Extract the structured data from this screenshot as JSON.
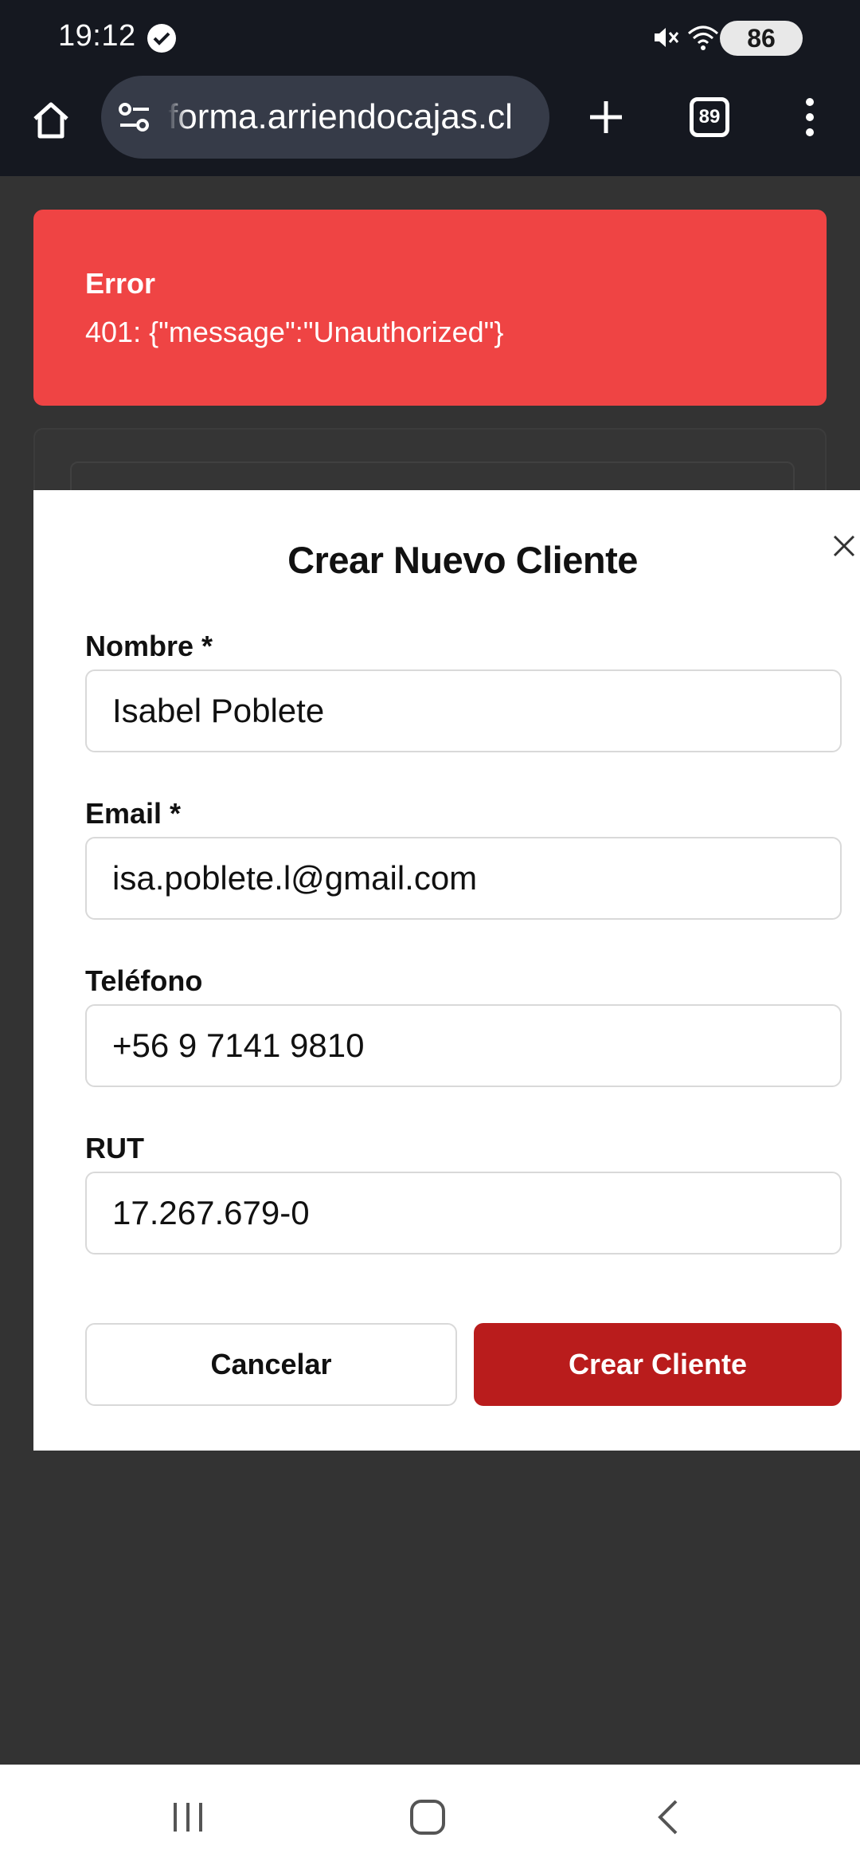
{
  "status_bar": {
    "time": "19:12",
    "battery": "86",
    "icons": [
      "check-circle-icon",
      "mute-icon",
      "wifi-icon",
      "signal-icon",
      "battery-icon"
    ]
  },
  "browser": {
    "url": "forma.arriendocajas.cl",
    "tab_count": "89"
  },
  "error": {
    "title": "Error",
    "message": "401: {\"message\":\"Unauthorized\"}",
    "color": "#ef4444"
  },
  "modal": {
    "title": "Crear Nuevo Cliente",
    "fields": [
      {
        "label": "Nombre *",
        "value": "Isabel Poblete"
      },
      {
        "label": "Email *",
        "value": "isa.poblete.l@gmail.com"
      },
      {
        "label": "Teléfono",
        "value": "+56 9 7141 9810"
      },
      {
        "label": "RUT",
        "value": "17.267.679-0"
      }
    ],
    "cancel_label": "Cancelar",
    "submit_label": "Crear Cliente",
    "submit_color": "#b91c1c"
  }
}
